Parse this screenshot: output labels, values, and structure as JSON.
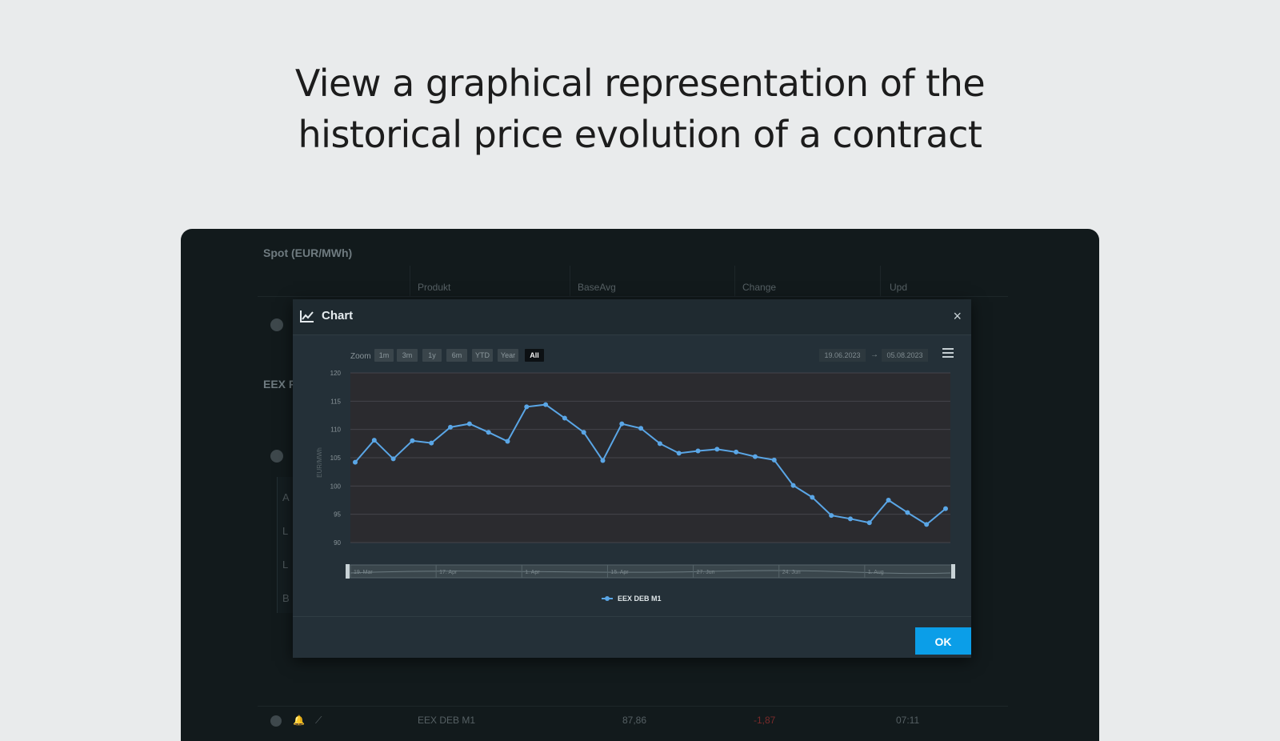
{
  "headline": {
    "line1": "View a graphical representation of the",
    "line2": "historical price evolution of a contract"
  },
  "background": {
    "section_title": "Spot (EUR/MWh)",
    "columns": [
      "Produkt",
      "BaseAvg",
      "Change",
      "Upd"
    ],
    "eex_title": "EEX P",
    "panel_letters": [
      "A",
      "L",
      "L",
      "B"
    ],
    "bottom_row": {
      "product": "EEX DEB M1",
      "base_avg": "87,86",
      "change": "-1,87",
      "upd": "07:11"
    }
  },
  "modal": {
    "title": "Chart",
    "close_label": "×",
    "ok_label": "OK",
    "icon": "line-chart-icon",
    "zoom_label": "Zoom",
    "zoom_buttons": [
      {
        "label": "1m",
        "active": false
      },
      {
        "label": "3m",
        "active": false
      },
      {
        "label": "1y",
        "active": false
      },
      {
        "label": "6m",
        "active": false
      },
      {
        "label": "YTD",
        "active": false
      },
      {
        "label": "Year",
        "active": false
      },
      {
        "label": "All",
        "active": true
      }
    ],
    "date_from": "19.06.2023",
    "date_sep": "→",
    "date_to": "05.08.2023",
    "menu_icon": "hamburger-menu-icon"
  },
  "chart_data": {
    "type": "line",
    "title": "",
    "xlabel": "",
    "ylabel": "EUR/MWh",
    "ylim": [
      90,
      120
    ],
    "y_ticks": [
      90,
      95,
      100,
      105,
      110,
      115,
      120
    ],
    "grid": true,
    "legend": "bottom-center",
    "series": [
      {
        "name": "EEX DEB M1",
        "color": "#5aa6e6",
        "values": [
          104.2,
          108.1,
          104.8,
          108.0,
          107.6,
          110.4,
          111.0,
          109.5,
          107.9,
          114.0,
          114.4,
          112.0,
          109.5,
          104.5,
          111.0,
          110.2,
          107.5,
          105.8,
          106.2,
          106.5,
          106.0,
          105.2,
          104.6,
          100.1,
          98.0,
          94.8,
          94.2,
          93.5,
          97.5,
          95.3,
          93.2,
          96.0
        ]
      }
    ],
    "navigator_labels": [
      "19. Mar",
      "17. Apr",
      "1. Apr",
      "15. Apr",
      "27. Jun",
      "24. Jun",
      "1. Aug"
    ]
  },
  "colors": {
    "accent": "#0b9ee8",
    "series": "#5aa6e6",
    "plot_bg": "#2b2b2f",
    "modal_bg": "#243038"
  }
}
